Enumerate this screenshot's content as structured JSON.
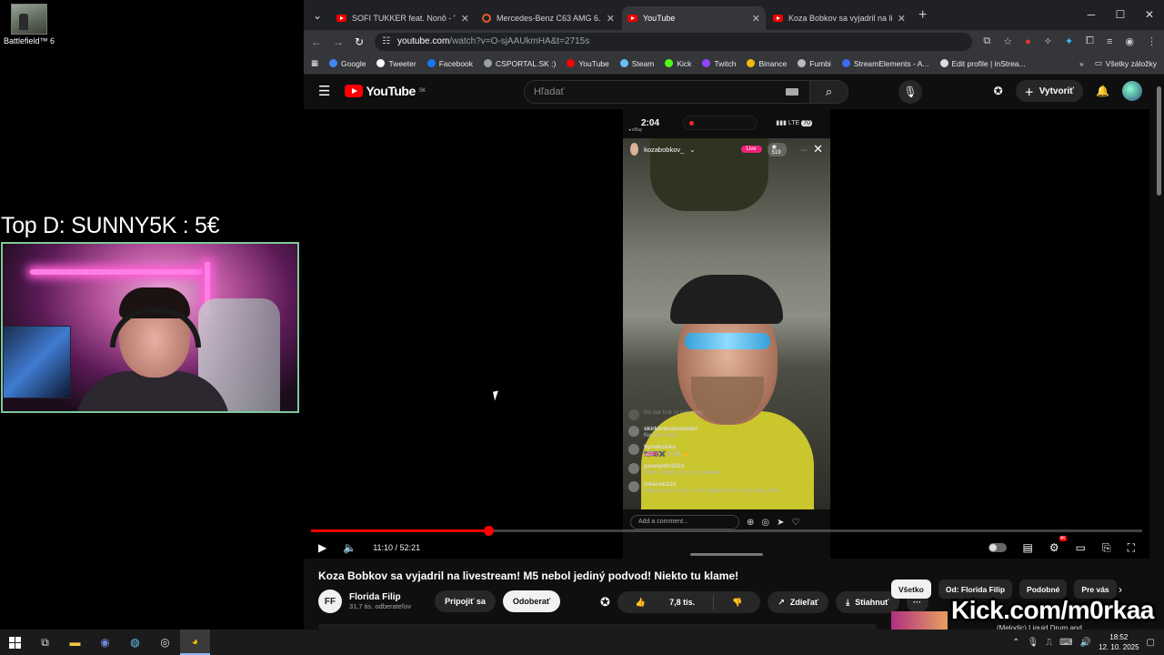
{
  "desktop": {
    "icon_label": "Battlefield™ 6",
    "overlay_text": "Top D: SUNNY5K : 5€"
  },
  "browser": {
    "tabs": [
      {
        "label": "SOFI TUKKER feat. Nonô - \"Pick",
        "active": false,
        "icon": "youtube-icon"
      },
      {
        "label": "Mercedes-Benz C63 AMG 6.2 V",
        "active": false,
        "icon": "mercedes-icon"
      },
      {
        "label": "YouTube",
        "active": true,
        "icon": "youtube-icon"
      },
      {
        "label": "Koza Bobkov sa vyjadril na livest",
        "active": false,
        "icon": "youtube-icon"
      }
    ],
    "url_host": "youtube.com",
    "url_path": "/watch?v=O-sjAAUkmHA&t=2715s",
    "bookmarks": [
      {
        "label": "Google",
        "color": "#4285f4"
      },
      {
        "label": "Tweeter",
        "color": "#ffffff"
      },
      {
        "label": "Facebook",
        "color": "#1877f2"
      },
      {
        "label": "CSPORTAL.SK :)",
        "color": "#9aa0a6"
      },
      {
        "label": "YouTube",
        "color": "#ff0000"
      },
      {
        "label": "Steam",
        "color": "#66c0f4"
      },
      {
        "label": "Kick",
        "color": "#53fc18"
      },
      {
        "label": "Twitch",
        "color": "#9146ff"
      },
      {
        "label": "Binance",
        "color": "#f0b90b"
      },
      {
        "label": "Fumbi",
        "color": "#bbbbbb"
      },
      {
        "label": "StreamElements - A...",
        "color": "#3a6df0"
      },
      {
        "label": "Edit profile | inStrea...",
        "color": "#dddddd"
      }
    ],
    "bookmarks_all": "Všetky záložky"
  },
  "youtube": {
    "logo_text": "YouTube",
    "logo_region": "SK",
    "search_placeholder": "Hľadať",
    "create_label": "Vytvoriť",
    "video": {
      "title": "Koza Bobkov sa vyjadril na livestream! M5 nebol jediný podvod! Niekto tu klame!",
      "time_current": "11:10",
      "time_total": "52:21",
      "progress": 0.213
    },
    "phone": {
      "clock": "2:04",
      "carrier": "◂ eBay",
      "network": "LTE",
      "battery": "70",
      "username": "kozabobkov_",
      "live_label": "Live",
      "viewers": "519",
      "comment_placeholder": "Add a comment...",
      "chat": [
        {
          "user": "",
          "msg": "No tak kuk ni nerarixkj",
          "faded": true
        },
        {
          "user": "skirkanicalexander",
          "msg": "Na čom ideš",
          "faded": false
        },
        {
          "user": "hynekzizka",
          "msg": "🇺🇸🇬🇧✖️  😡😂🙌",
          "faded": false
        },
        {
          "user": "pavelpetr3323",
          "msg": "Nikdo žádny nic co ty neděla",
          "faded": false
        },
        {
          "user": "lukacek123",
          "msg": "Hlavna vec že ty si ten najlepsi more dig vlasy kefa",
          "faded": false
        }
      ]
    },
    "channel": {
      "name": "Florida Filip",
      "subscribers": "31,7 tis. odberateľov",
      "join_label": "Pripojiť sa",
      "subscribe_label": "Odoberať"
    },
    "actions": {
      "likes": "7,8 tis.",
      "share": "Zdieľať",
      "download": "Stiahnuť"
    },
    "chips": [
      "Všetko",
      "Od: Florida Filip",
      "Podobné",
      "Pre vás"
    ]
  },
  "overlay": {
    "kick_text": "Kick.com/m0rkaa",
    "kick_under": "(Melodic) Liquid Drum and"
  },
  "taskbar": {
    "time": "18:52",
    "date": "12. 10. 2025"
  }
}
